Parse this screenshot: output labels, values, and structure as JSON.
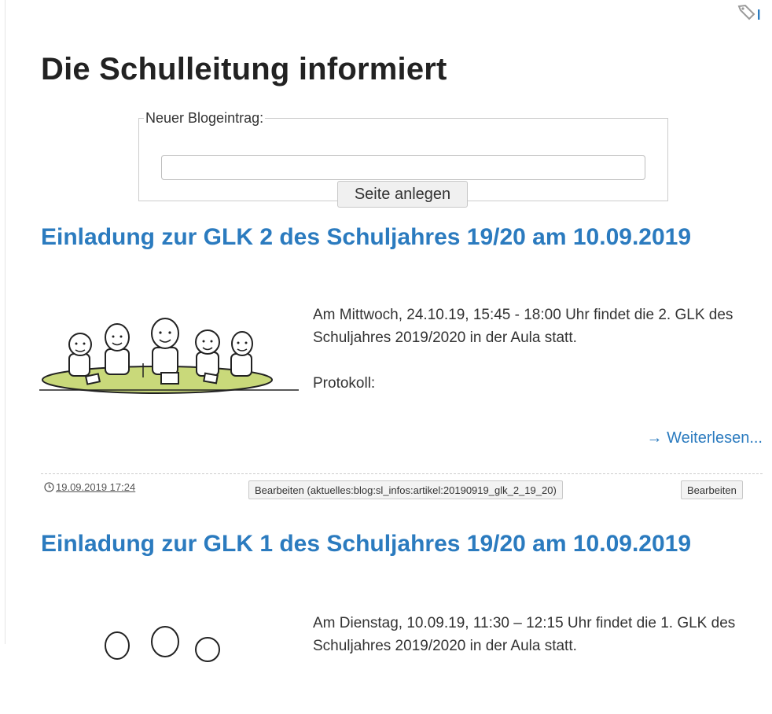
{
  "page": {
    "title": "Die Schulleitung informiert"
  },
  "new_entry": {
    "legend": "Neuer Blogeintrag:",
    "input_value": "",
    "button_label": "Seite anlegen"
  },
  "posts": [
    {
      "title": "Einladung zur GLK 2 des Schuljahres 19/20 am 10.09.2019",
      "paragraphs": [
        "Am Mittwoch, 24.10.19, 15:45 - 18:00 Uhr findet die 2. GLK des Schuljahres 2019/2020 in der Aula statt.",
        "Protokoll:"
      ],
      "read_more": "→ Weiterlesen...",
      "date": "19.09.2019 17:24",
      "edit_section_label": "Bearbeiten (aktuelles:blog:sl_infos:artikel:20190919_glk_2_19_20)",
      "edit_label": "Bearbeiten"
    },
    {
      "title": "Einladung zur GLK 1 des Schuljahres 19/20 am 10.09.2019",
      "paragraphs": [
        "Am Dienstag, 10.09.19, 11:30 – 12:15 Uhr findet die 1. GLK des Schuljahres 2019/2020 in der Aula statt."
      ]
    }
  ],
  "icons": {
    "tag": "tag-icon",
    "clock": "clock-icon",
    "illustration": "meeting-illustration"
  },
  "colors": {
    "link": "#2b7bbf",
    "heading": "#222222",
    "table": "#c9d97a"
  }
}
